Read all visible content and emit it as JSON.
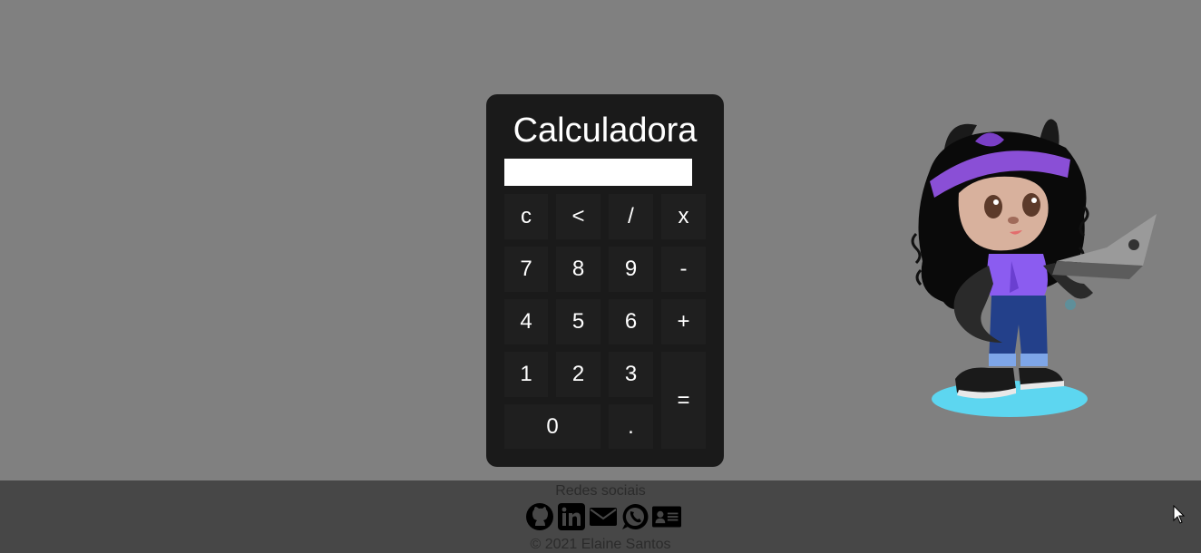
{
  "calculator": {
    "title": "Calculadora",
    "display_value": "",
    "keys": [
      {
        "id": "clear",
        "label": "c"
      },
      {
        "id": "backspace",
        "label": "<"
      },
      {
        "id": "divide",
        "label": "/"
      },
      {
        "id": "multiply",
        "label": "x"
      },
      {
        "id": "seven",
        "label": "7"
      },
      {
        "id": "eight",
        "label": "8"
      },
      {
        "id": "nine",
        "label": "9"
      },
      {
        "id": "minus",
        "label": "-"
      },
      {
        "id": "four",
        "label": "4"
      },
      {
        "id": "five",
        "label": "5"
      },
      {
        "id": "six",
        "label": "6"
      },
      {
        "id": "plus",
        "label": "+"
      },
      {
        "id": "one",
        "label": "1"
      },
      {
        "id": "two",
        "label": "2"
      },
      {
        "id": "three",
        "label": "3"
      },
      {
        "id": "equals",
        "label": "="
      },
      {
        "id": "zero",
        "label": "0"
      },
      {
        "id": "decimal",
        "label": "."
      }
    ]
  },
  "illustration": {
    "icon": "octocat-girl-with-laptop",
    "colors": {
      "bandana": "#8a4fd6",
      "shirt": "#8b5cf0",
      "jeans": "#23408a",
      "shadow": "#5dd6f0"
    }
  },
  "footer": {
    "heading": "Redes sociais",
    "links": [
      {
        "icon": "github-icon"
      },
      {
        "icon": "linkedin-icon"
      },
      {
        "icon": "email-icon"
      },
      {
        "icon": "whatsapp-icon"
      },
      {
        "icon": "contact-card-icon"
      }
    ],
    "copyright": "© 2021 Elaine Santos"
  },
  "theme": {
    "page_bg": "#808080",
    "calculator_bg": "#1a1a1a",
    "key_bg": "#1f1f1f",
    "footer_bg": "#474747",
    "footer_text": "#2b2b2b"
  }
}
